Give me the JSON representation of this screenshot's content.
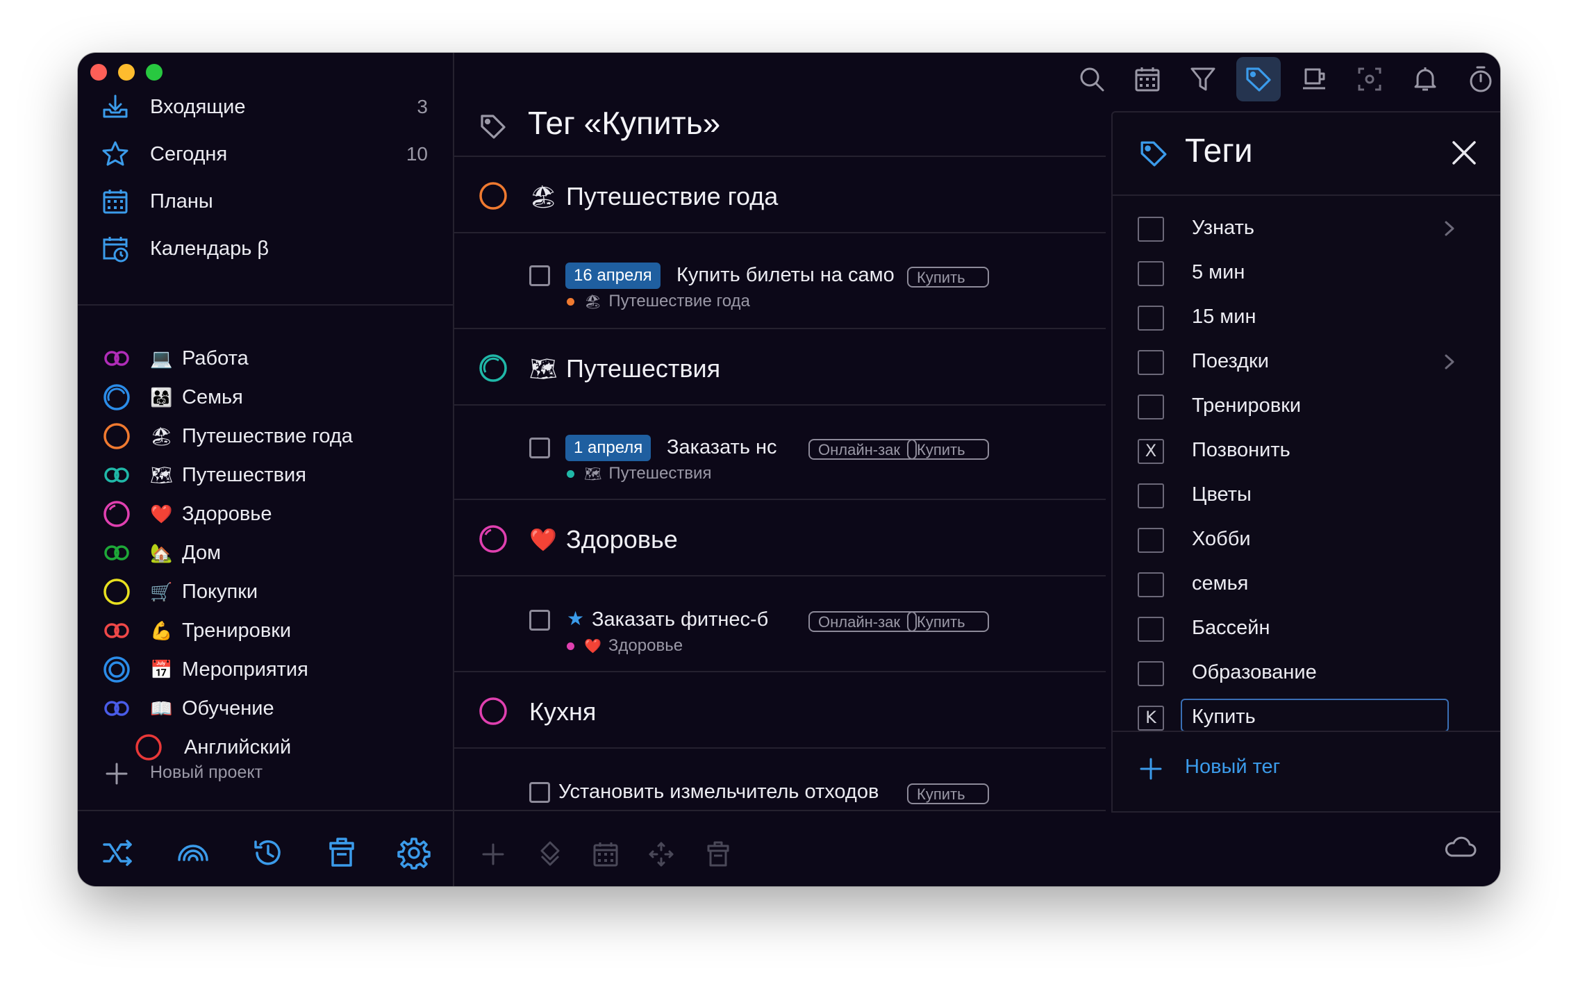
{
  "sidebar": {
    "nav": [
      {
        "label": "Входящие",
        "count": "3",
        "icon": "inbox-icon"
      },
      {
        "label": "Сегодня",
        "count": "10",
        "icon": "star-icon"
      },
      {
        "label": "Планы",
        "count": "",
        "icon": "calendar-icon"
      },
      {
        "label": "Календарь β",
        "count": "",
        "icon": "calendar-clock-icon"
      }
    ],
    "projects": [
      {
        "label": "Работа",
        "emoji": "💻",
        "color": "#b02db8"
      },
      {
        "label": "Семья",
        "emoji": "👨‍👩‍👧",
        "color": "#2b8ce8"
      },
      {
        "label": "Путешествие года",
        "emoji": "🏖",
        "color": "#f07a30"
      },
      {
        "label": "Путешествия",
        "emoji": "🗺",
        "color": "#20b8a8"
      },
      {
        "label": "Здоровье",
        "emoji": "❤️",
        "color": "#e040b0"
      },
      {
        "label": "Дом",
        "emoji": "🏡",
        "color": "#1ea838"
      },
      {
        "label": "Покупки",
        "emoji": "🛒",
        "color": "#e8e020"
      },
      {
        "label": "Тренировки",
        "emoji": "💪",
        "color": "#f04848"
      },
      {
        "label": "Мероприятия",
        "emoji": "📅",
        "color": "#2b8ce8"
      },
      {
        "label": "Обучение",
        "emoji": "📖",
        "color": "#4a5ce8"
      },
      {
        "label": "Английский",
        "emoji": "",
        "color": "#e83838"
      }
    ],
    "new_project": "Новый проект",
    "accent": "#3b9bea"
  },
  "main": {
    "title": "Тег «Купить»",
    "groups": [
      {
        "label": "Путешествие года",
        "emoji": "🏖",
        "color": "#f07a30"
      },
      {
        "label": "Путешествия",
        "emoji": "🗺",
        "color": "#20b8a8"
      },
      {
        "label": "Здоровье",
        "emoji": "❤️",
        "color": "#e040b0"
      },
      {
        "label": "Кухня",
        "emoji": "",
        "color": "#e040b0"
      }
    ],
    "tasks": [
      {
        "date": "16 апреля",
        "title": "Купить билеты на само",
        "tags": [
          "Купить"
        ],
        "project": "Путешествие года",
        "project_emoji": "🏖",
        "dot": "#f07a30"
      },
      {
        "date": "1 апреля",
        "title": "Заказать нс",
        "tags": [
          "Онлайн-зак",
          "Купить"
        ],
        "project": "Путешествия",
        "project_emoji": "🗺",
        "dot": "#20b8a8"
      },
      {
        "date": "",
        "title": "Заказать фитнес-б",
        "tags": [
          "Онлайн-зак",
          "Купить"
        ],
        "project": "Здоровье",
        "project_emoji": "❤️",
        "dot": "#e040b0"
      },
      {
        "date": "",
        "title": "Установить измельчитель отходов",
        "tags": [
          "Купить"
        ],
        "project": "",
        "project_emoji": "",
        "dot": ""
      }
    ]
  },
  "toolbar": {
    "icons": [
      "search-icon",
      "calendar-icon",
      "filter-icon",
      "tag-icon",
      "coffee-icon",
      "focus-icon",
      "bell-icon",
      "timer-icon",
      "copy-icon"
    ],
    "active": "tag-icon"
  },
  "tags_panel": {
    "title": "Теги",
    "tags": [
      {
        "label": "Узнать",
        "key": "",
        "has_children": true
      },
      {
        "label": "5 мин",
        "key": "",
        "has_children": false
      },
      {
        "label": "15 мин",
        "key": "",
        "has_children": false
      },
      {
        "label": "Поездки",
        "key": "",
        "has_children": true
      },
      {
        "label": "Тренировки",
        "key": "",
        "has_children": false
      },
      {
        "label": "Позвонить",
        "key": "X",
        "has_children": false
      },
      {
        "label": "Цветы",
        "key": "",
        "has_children": false
      },
      {
        "label": "Хобби",
        "key": "",
        "has_children": false
      },
      {
        "label": "семья",
        "key": "",
        "has_children": false
      },
      {
        "label": "Бассейн",
        "key": "",
        "has_children": false
      },
      {
        "label": "Образование",
        "key": "",
        "has_children": false
      },
      {
        "label": "Купить",
        "key": "K",
        "has_children": false
      }
    ],
    "new_tag": "Новый тег"
  }
}
